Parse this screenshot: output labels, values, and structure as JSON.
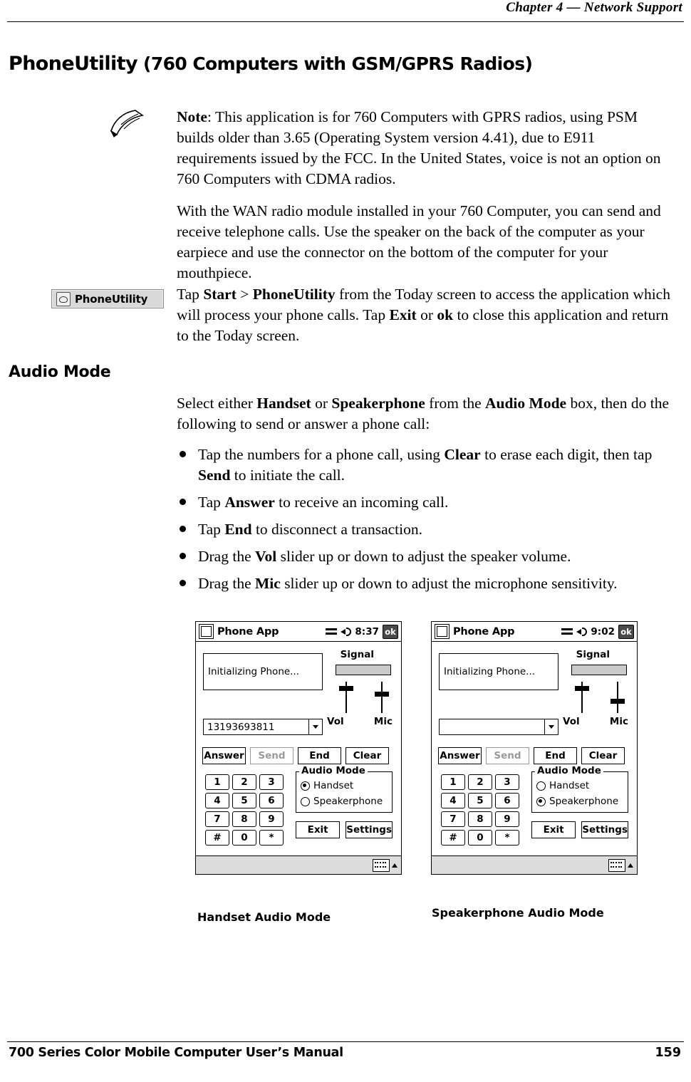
{
  "header": {
    "chapter": "Chapter  4  —  Network Support"
  },
  "title": {
    "main": "PhoneUtility",
    "rest": "(760 Computers with GSM/GPRS Radios)"
  },
  "note": {
    "label": "Note",
    "text": ": This application is for 760 Computers with GPRS radios, using PSM builds older than 3.65 (Operating System version 4.41), due to E911 requirements issued by the FCC. In the United States, voice is not an option on 760 Computers with CDMA radios."
  },
  "paragraphs": {
    "wan": "With the WAN radio module installed in your 760 Computer, you can send and receive telephone calls. Use the speaker on the back of the computer as your earpiece and use the connector on the bottom of the computer for your mouthpiece.",
    "tap_start_pre": "Tap ",
    "tap_start_b1": "Start",
    "tap_start_mid1": " > ",
    "tap_start_b2": "PhoneUtility",
    "tap_start_mid2": " from the Today screen to access the application which will process your phone calls. Tap ",
    "tap_start_b3": "Exit",
    "tap_start_mid3": " or ",
    "tap_start_b4": "ok",
    "tap_start_end": " to close this application and return to the Today screen."
  },
  "phoneutility_badge": {
    "label": "PhoneUtility"
  },
  "audio_mode_section": {
    "heading": "Audio Mode",
    "intro_pre": "Select either ",
    "intro_b1": "Handset",
    "intro_mid1": " or ",
    "intro_b2": "Speakerphone",
    "intro_mid2": " from the ",
    "intro_b3": "Audio Mode",
    "intro_end": " box, then do the following to send or answer a phone call:",
    "bullets": [
      {
        "pre": "Tap the numbers for a phone call, using ",
        "b1": "Clear",
        "mid": " to erase each digit, then tap ",
        "b2": "Send",
        "end": " to initiate the call."
      },
      {
        "pre": "Tap ",
        "b1": "Answer",
        "mid": "",
        "b2": "",
        "end": " to receive an incoming call."
      },
      {
        "pre": "Tap ",
        "b1": "End",
        "mid": "",
        "b2": "",
        "end": " to disconnect a transaction."
      },
      {
        "pre": "Drag the ",
        "b1": "Vol",
        "mid": "",
        "b2": "",
        "end": " slider up or down to adjust the speaker volume."
      },
      {
        "pre": "Drag the ",
        "b1": "Mic",
        "mid": "",
        "b2": "",
        "end": " slider up or down to adjust the microphone sensitivity."
      }
    ]
  },
  "screenshots": {
    "left": {
      "app_title": "Phone App",
      "clock": "8:37",
      "ok_label": "ok",
      "status_text": "Initializing Phone...",
      "signal_label": "Signal",
      "vol_label": "Vol",
      "mic_label": "Mic",
      "number": "13193693811",
      "buttons": {
        "answer": "Answer",
        "send": "Send",
        "end": "End",
        "clear": "Clear",
        "exit": "Exit",
        "settings": "Settings"
      },
      "keypad": [
        "1",
        "2",
        "3",
        "4",
        "5",
        "6",
        "7",
        "8",
        "9",
        "#",
        "0",
        "*"
      ],
      "audio_group_label": "Audio Mode",
      "radio_handset": "Handset",
      "radio_speakerphone": "Speakerphone",
      "selected_mode": "Handset",
      "caption": "Handset Audio Mode"
    },
    "right": {
      "app_title": "Phone App",
      "clock": "9:02",
      "ok_label": "ok",
      "status_text": "Initializing Phone...",
      "signal_label": "Signal",
      "vol_label": "Vol",
      "mic_label": "Mic",
      "number": "",
      "buttons": {
        "answer": "Answer",
        "send": "Send",
        "end": "End",
        "clear": "Clear",
        "exit": "Exit",
        "settings": "Settings"
      },
      "keypad": [
        "1",
        "2",
        "3",
        "4",
        "5",
        "6",
        "7",
        "8",
        "9",
        "#",
        "0",
        "*"
      ],
      "audio_group_label": "Audio Mode",
      "radio_handset": "Handset",
      "radio_speakerphone": "Speakerphone",
      "selected_mode": "Speakerphone",
      "caption": "Speakerphone Audio Mode"
    }
  },
  "footer": {
    "left": "700 Series Color Mobile Computer User’s Manual",
    "page": "159"
  }
}
